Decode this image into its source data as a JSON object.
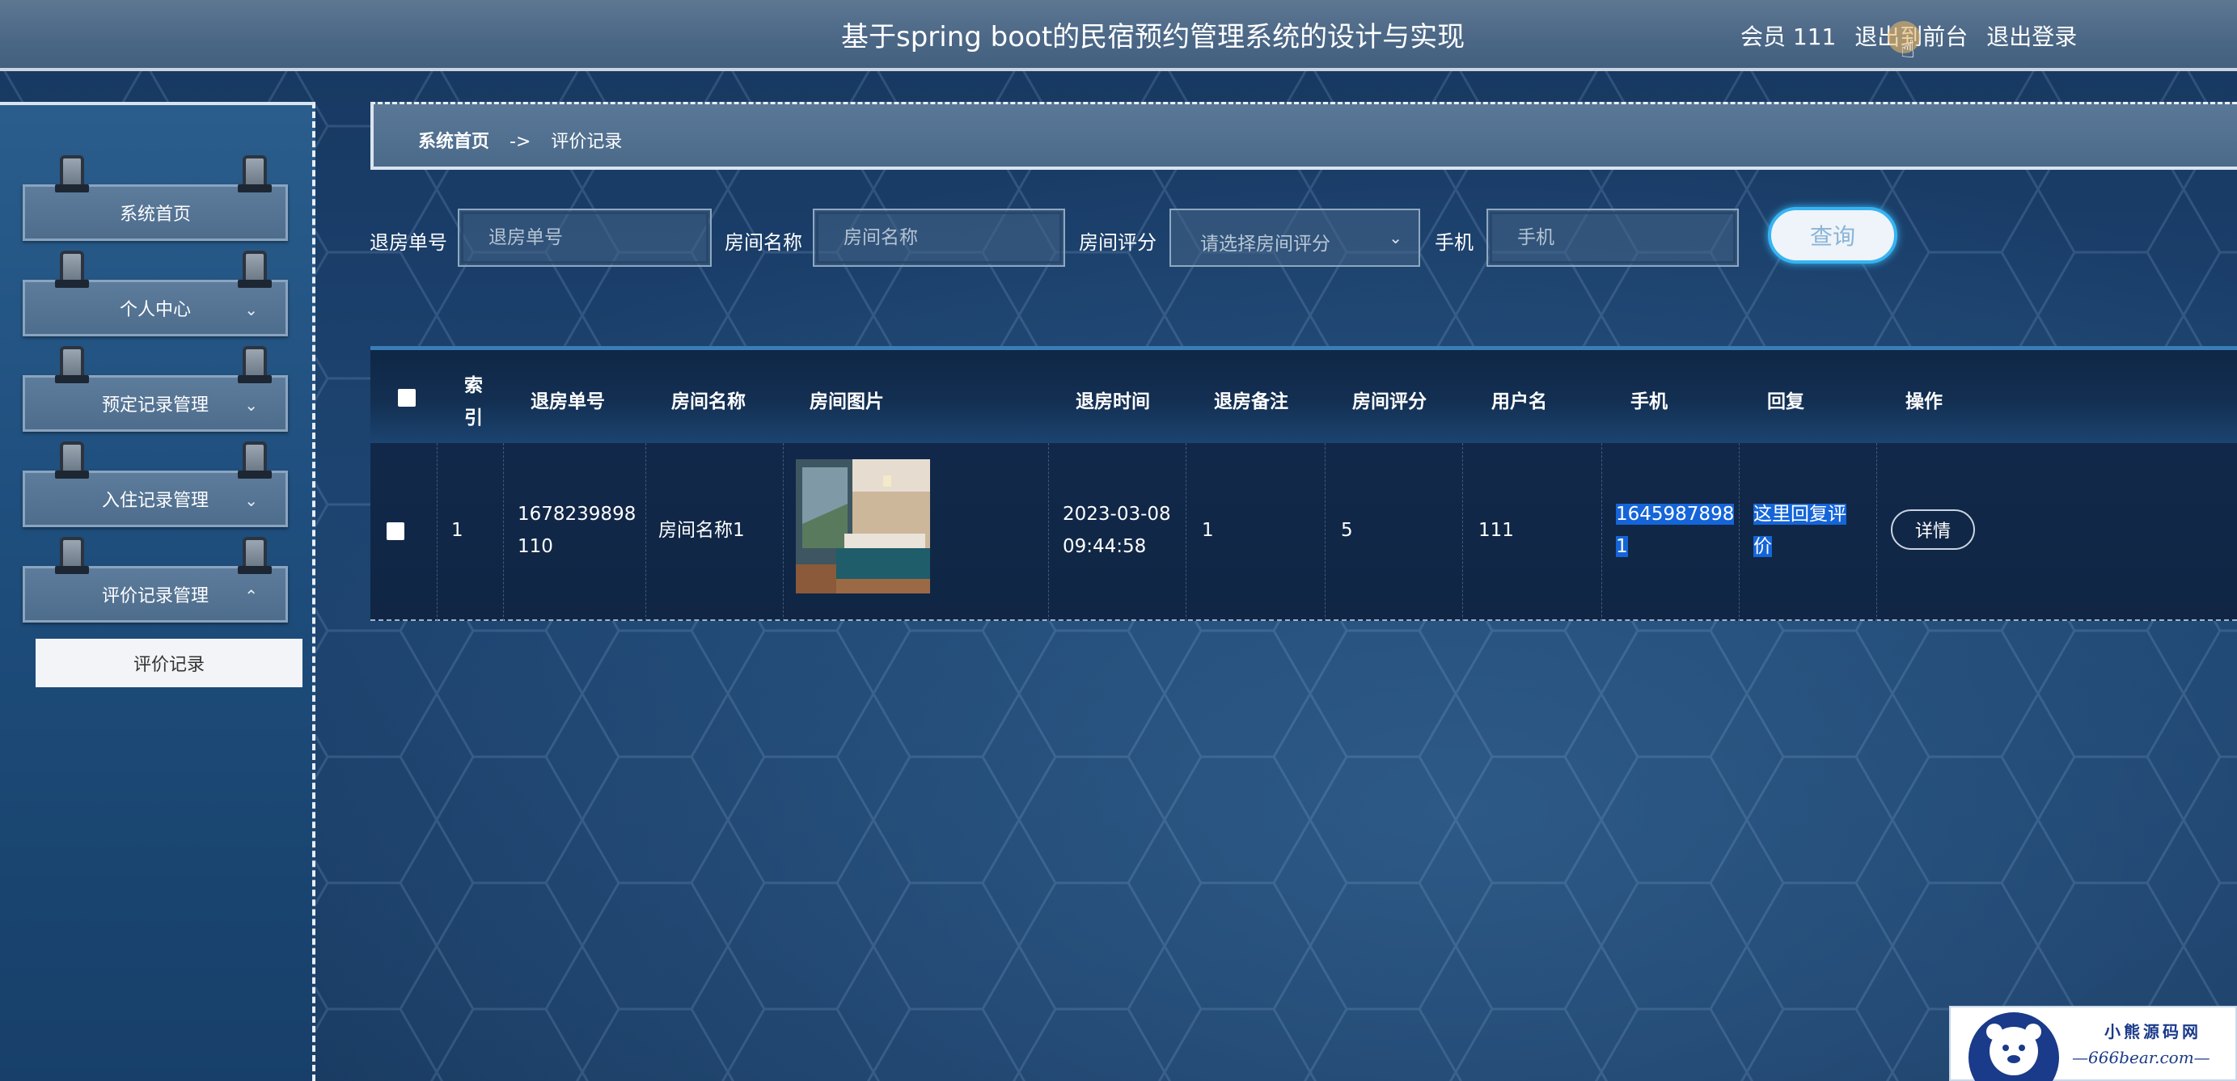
{
  "app": {
    "title": "基于spring boot的民宿预约管理系统的设计与实现",
    "user_label": "会员 111",
    "exit_to_front": "退出到前台",
    "logout": "退出登录"
  },
  "sidebar": {
    "items": [
      {
        "label": "系统首页",
        "has_chevron": false
      },
      {
        "label": "个人中心",
        "has_chevron": true,
        "chevron": "⌄"
      },
      {
        "label": "预定记录管理",
        "has_chevron": true,
        "chevron": "⌄"
      },
      {
        "label": "入住记录管理",
        "has_chevron": true,
        "chevron": "⌄"
      },
      {
        "label": "评价记录管理",
        "has_chevron": true,
        "chevron": "⌃"
      }
    ],
    "submenu": {
      "label": "评价记录"
    }
  },
  "breadcrumb": {
    "home": "系统首页",
    "separator": "->",
    "current": "评价记录"
  },
  "search": {
    "checkout_no_label": "退房单号",
    "checkout_no_placeholder": "退房单号",
    "room_name_label": "房间名称",
    "room_name_placeholder": "房间名称",
    "rating_label": "房间评分",
    "rating_placeholder": "请选择房间评分",
    "phone_label": "手机",
    "phone_placeholder": "手机",
    "query_button": "查询"
  },
  "table": {
    "headers": {
      "index_line1": "索",
      "index_line2": "引",
      "checkout_no": "退房单号",
      "room_name": "房间名称",
      "room_image": "房间图片",
      "checkout_time": "退房时间",
      "remark": "退房备注",
      "rating": "房间评分",
      "username": "用户名",
      "phone": "手机",
      "reply": "回复",
      "actions": "操作"
    },
    "rows": [
      {
        "index": "1",
        "checkout_no_line1": "1678239898",
        "checkout_no_line2": "110",
        "room_name": "房间名称1",
        "checkout_time_line1": "2023-03-08",
        "checkout_time_line2": "09:44:58",
        "remark": "1",
        "rating": "5",
        "username": "111",
        "phone_line1": "1645987898",
        "phone_line2": "1",
        "reply_line1": "这里回复评",
        "reply_line2": "价",
        "detail_button": "详情"
      }
    ]
  },
  "watermark": {
    "line1": "小熊源码网",
    "line2": "—666bear.com—"
  },
  "colors": {
    "accent": "#37b3f2",
    "highlight": "#1565d8",
    "header_bg": "#4b6786"
  }
}
